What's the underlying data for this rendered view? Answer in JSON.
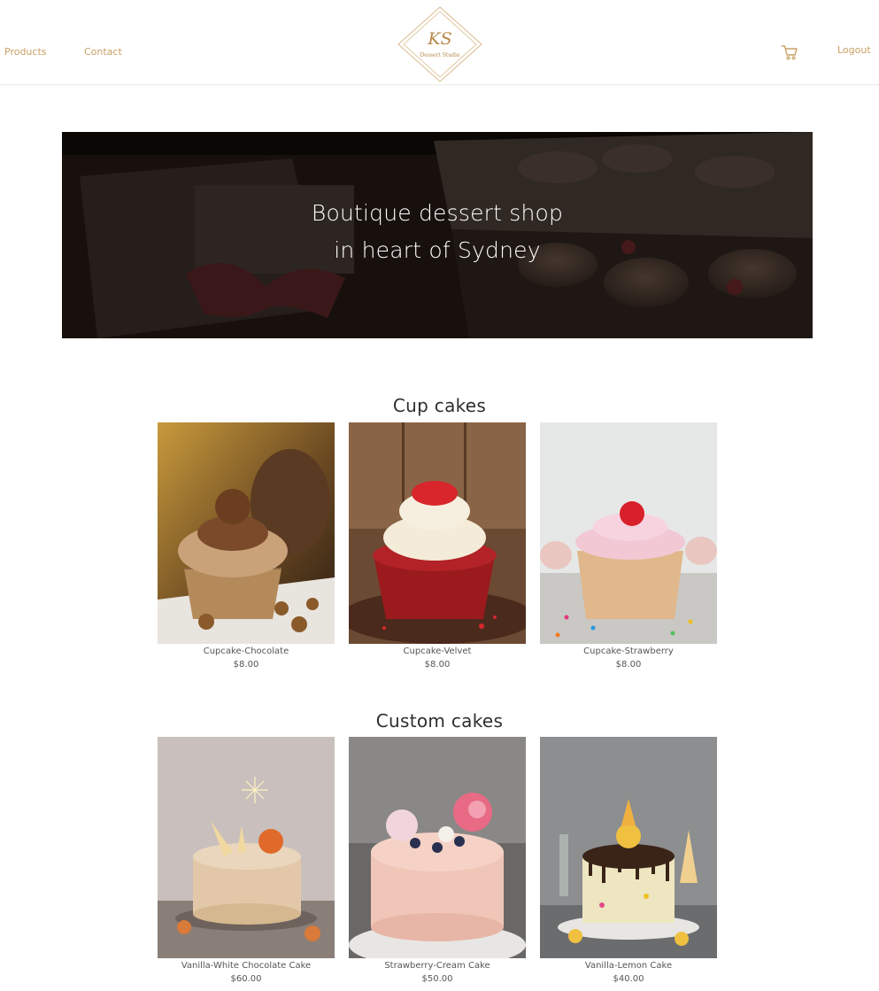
{
  "nav": {
    "products": "Products",
    "contact": "Contact",
    "logout": "Logout",
    "cart_icon": "shopping-cart-icon"
  },
  "logo": {
    "initials": "KS",
    "subtitle": "Dessert Studio"
  },
  "hero": {
    "line1": "Boutique dessert shop",
    "line2": "in heart of Sydney"
  },
  "sections": [
    {
      "title": "Cup cakes",
      "products": [
        {
          "name": "Cupcake-Chocolate",
          "price": "$8.00"
        },
        {
          "name": "Cupcake-Velvet",
          "price": "$8.00"
        },
        {
          "name": "Cupcake-Strawberry",
          "price": "$8.00"
        }
      ]
    },
    {
      "title": "Custom cakes",
      "products": [
        {
          "name": "Vanilla-White Chocolate Cake",
          "price": "$60.00"
        },
        {
          "name": "Strawberry-Cream Cake",
          "price": "$50.00"
        },
        {
          "name": "Vanilla-Lemon Cake",
          "price": "$40.00"
        }
      ]
    }
  ],
  "colors": {
    "accent": "#c8a165",
    "hero_background": "#1d1410",
    "text": "#555555"
  }
}
